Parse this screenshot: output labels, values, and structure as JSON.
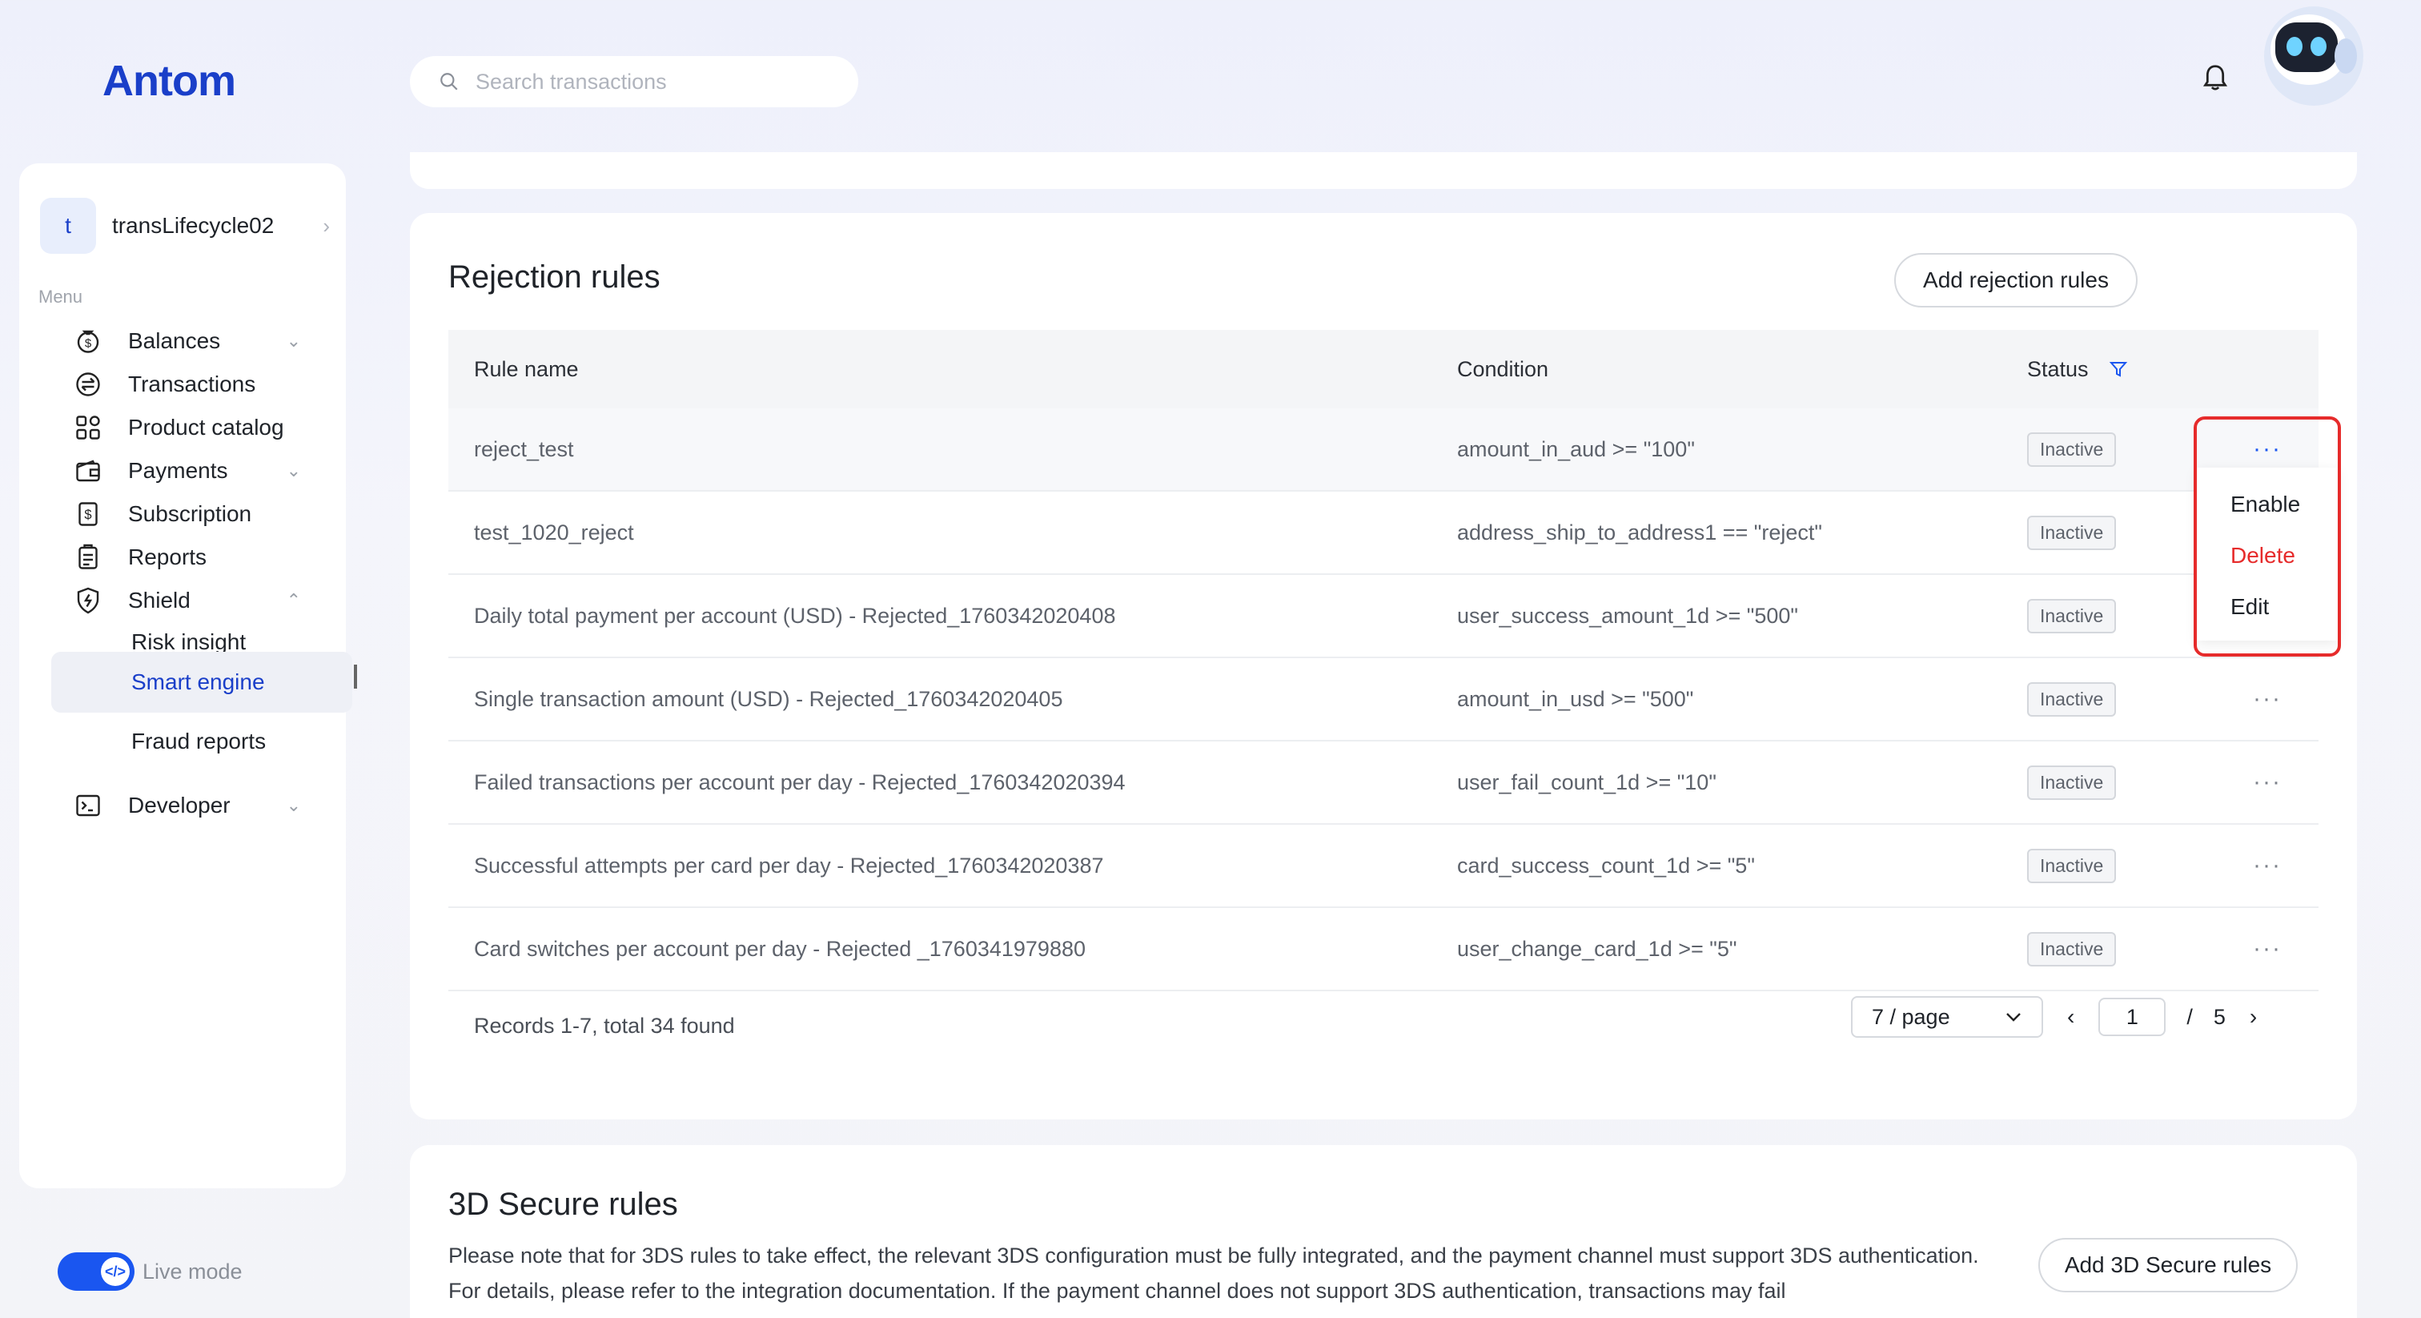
{
  "brand": {
    "logo": "Antom"
  },
  "search": {
    "placeholder": "Search transactions"
  },
  "sidebar": {
    "account_initial": "t",
    "account_name": "transLifecycle02",
    "menu_label": "Menu",
    "items": [
      {
        "label": "Balances",
        "icon": "money-bag-icon",
        "caret": "down"
      },
      {
        "label": "Transactions",
        "icon": "transfer-icon",
        "caret": ""
      },
      {
        "label": "Product catalog",
        "icon": "grid-icon",
        "caret": ""
      },
      {
        "label": "Payments",
        "icon": "wallet-icon",
        "caret": "down"
      },
      {
        "label": "Subscription",
        "icon": "dollar-doc-icon",
        "caret": ""
      },
      {
        "label": "Reports",
        "icon": "clipboard-icon",
        "caret": ""
      },
      {
        "label": "Shield",
        "icon": "shield-icon",
        "caret": "up"
      },
      {
        "label": "Risk insight"
      },
      {
        "label": "Smart engine",
        "active": true
      },
      {
        "label": "Fraud reports"
      },
      {
        "label": "Developer",
        "icon": "terminal-icon",
        "caret": "down"
      }
    ],
    "live_mode_label": "Live mode",
    "live_mode_on": true
  },
  "rejection": {
    "title": "Rejection rules",
    "add_button": "Add rejection rules",
    "columns": {
      "rule_name": "Rule name",
      "condition": "Condition",
      "status": "Status"
    },
    "rows": [
      {
        "name": "reject_test",
        "condition": "amount_in_aud >= \"100\"",
        "status": "Inactive"
      },
      {
        "name": "test_1020_reject",
        "condition": "address_ship_to_address1 == \"reject\"",
        "status": "Inactive"
      },
      {
        "name": "Daily total payment per account (USD) - Rejected_1760342020408",
        "condition": "user_success_amount_1d >= \"500\"",
        "status": "Inactive"
      },
      {
        "name": "Single transaction amount (USD) - Rejected_1760342020405",
        "condition": "amount_in_usd >= \"500\"",
        "status": "Inactive"
      },
      {
        "name": "Failed transactions per account per day - Rejected_1760342020394",
        "condition": "user_fail_count_1d >= \"10\"",
        "status": "Inactive"
      },
      {
        "name": "Successful attempts per card per day - Rejected_1760342020387",
        "condition": "card_success_count_1d >= \"5\"",
        "status": "Inactive"
      },
      {
        "name": "Card switches per account per day - Rejected _1760341979880",
        "condition": "user_change_card_1d >= \"5\"",
        "status": "Inactive"
      }
    ],
    "more_label": "···",
    "records_text": "Records 1-7, total 34 found",
    "page_size": "7 / page",
    "current_page": "1",
    "page_separator": "/",
    "total_pages": "5",
    "dropdown": {
      "enable": "Enable",
      "delete": "Delete",
      "edit": "Edit"
    }
  },
  "three_ds": {
    "title": "3D Secure rules",
    "add_button": "Add 3D Secure rules",
    "description": "Please note that for 3DS rules to take effect, the relevant 3DS configuration must be fully integrated, and the payment channel must support 3DS authentication. For details, please refer to the integration documentation. If the payment channel does not support 3DS authentication, transactions may fail"
  },
  "colors": {
    "accent": "#1a56f0",
    "brand": "#1a3fc9",
    "danger": "#e62b2b"
  }
}
